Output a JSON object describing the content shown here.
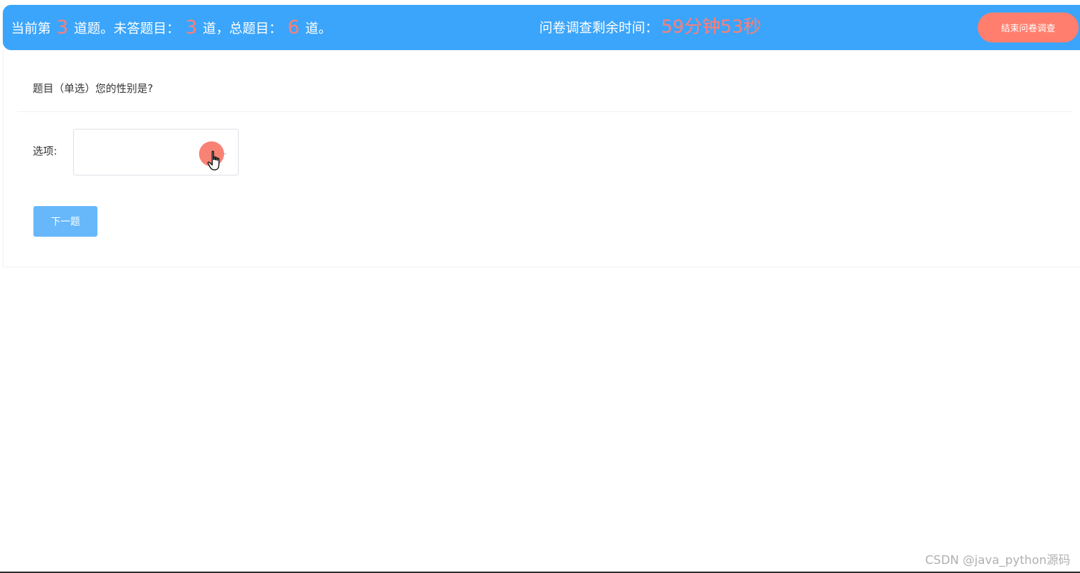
{
  "header": {
    "progress_prefix": "当前第",
    "current_num": "3",
    "progress_mid1": "道题。未答题目：",
    "unanswered_num": "3",
    "progress_mid2": "道，总题目：",
    "total_num": "6",
    "progress_suffix": "道。",
    "timer_label": "问卷调查剩余时间：",
    "timer_value": "59分钟53秒",
    "end_button_label": "结束问卷调查"
  },
  "question": {
    "text": "题目（单选）您的性别是?",
    "options_label": "选项:",
    "select_value": ""
  },
  "actions": {
    "next_label": "下一题"
  },
  "watermark": "CSDN @java_python源码",
  "colors": {
    "header_bg": "#3ba5fb",
    "accent_number": "#ff7e76",
    "end_button": "#ff7e6e",
    "next_button": "#66b8fb"
  },
  "icons": {
    "select_arrow": "chevron-down-icon",
    "cursor": "hand-pointer-icon"
  }
}
